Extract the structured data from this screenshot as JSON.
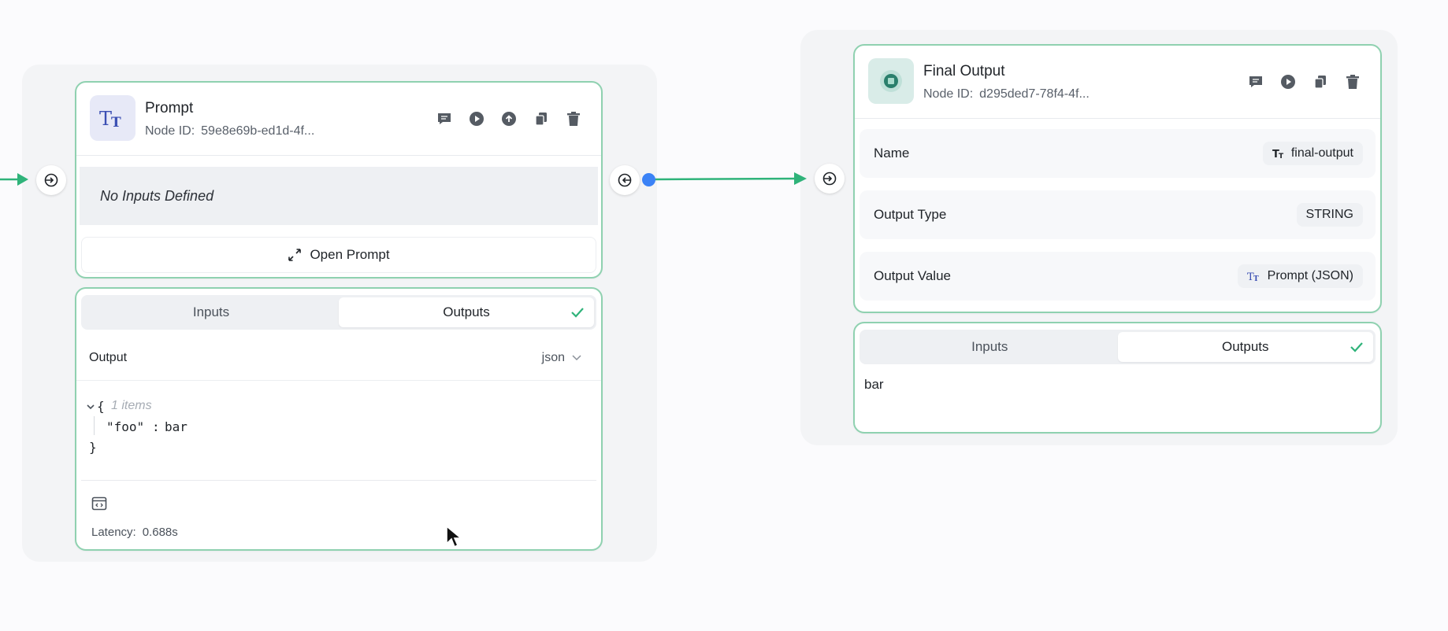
{
  "prompt_node": {
    "title": "Prompt",
    "node_id_label": "Node ID:",
    "node_id": "59e8e69b-ed1d-4f...",
    "icon": "text-type-icon",
    "actions": [
      "comment-icon",
      "play-icon",
      "upload-icon",
      "copy-icon",
      "trash-icon"
    ],
    "empty_inputs": "No Inputs Defined",
    "open_button": "Open Prompt",
    "tabs": [
      "Inputs",
      "Outputs"
    ],
    "active_tab": "Outputs",
    "output_label": "Output",
    "format_value": "json",
    "json": {
      "open_brace": "{",
      "count": "1 items",
      "key": "\"foo\"",
      "colon": ":",
      "value": "bar",
      "close_brace": "}"
    },
    "latency_label": "Latency:",
    "latency_value": "0.688s"
  },
  "final_node": {
    "title": "Final Output",
    "node_id_label": "Node ID:",
    "node_id": "d295ded7-78f4-4f...",
    "actions": [
      "comment-icon",
      "play-icon",
      "copy-icon",
      "trash-icon"
    ],
    "fields": [
      {
        "label": "Name",
        "value": "final-output",
        "icon": "text-type-icon"
      },
      {
        "label": "Output Type",
        "value": "STRING"
      },
      {
        "label": "Output Value",
        "value": "Prompt (JSON)",
        "icon": "text-type-icon"
      }
    ],
    "tabs": [
      "Inputs",
      "Outputs"
    ],
    "active_tab": "Outputs",
    "result": "bar"
  },
  "colors": {
    "accent_green": "#2fb37a",
    "node_border": "#8fd1b0",
    "port_dot": "#3b82f6",
    "icon_blue": "#3b4fb3"
  }
}
